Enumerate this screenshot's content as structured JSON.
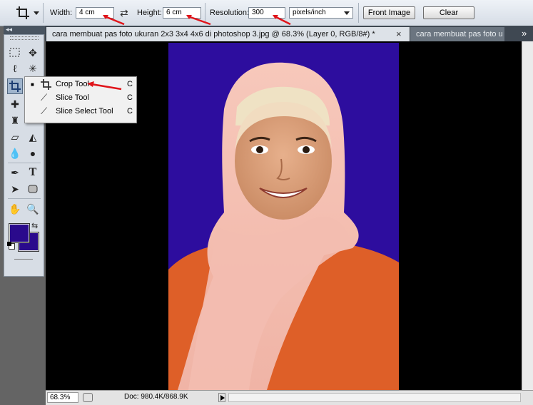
{
  "options_bar": {
    "width_label": "Width:",
    "width_value": "4 cm",
    "swap_icon": "⇄",
    "height_label": "Height:",
    "height_value": "6 cm",
    "resolution_label": "Resolution:",
    "resolution_value": "300",
    "resolution_unit": "pixels/inch",
    "front_image_label": "Front Image",
    "clear_label": "Clear"
  },
  "panel_header": "◂◂",
  "tabs": {
    "active": "cara membuat pas foto ukuran 2x3 3x4 4x6 di photoshop 3.jpg @ 68.3% (Layer 0, RGB/8#) *",
    "active_close": "×",
    "inactive": "cara membuat pas foto u",
    "overflow": "»"
  },
  "flyout": {
    "items": [
      {
        "label": "Crop Tool",
        "key": "C",
        "icon": "crop-icon",
        "glyph": "⌗",
        "selected_marker": "■"
      },
      {
        "label": "Slice Tool",
        "key": "C",
        "icon": "slice-icon",
        "glyph": "⟋",
        "selected_marker": ""
      },
      {
        "label": "Slice Select Tool",
        "key": "C",
        "icon": "slice-select-icon",
        "glyph": "⟋",
        "selected_marker": ""
      }
    ]
  },
  "status": {
    "zoom": "68.3%",
    "doc": "Doc: 980.4K/868.9K"
  },
  "colors": {
    "foreground": "#2a0a8c",
    "background": "#2a0a8c",
    "photo_background": "#2d0d9e",
    "annotation_arrow": "#e0141a"
  }
}
